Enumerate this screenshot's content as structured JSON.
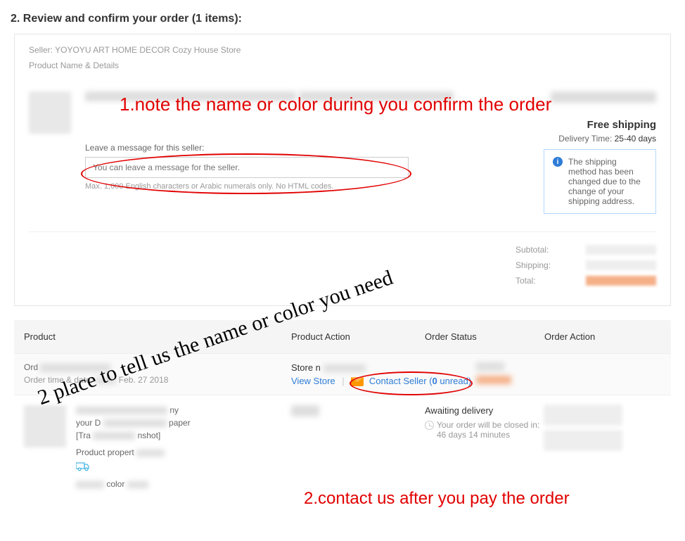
{
  "page_title": "2. Review and confirm your order (1 items):",
  "seller": {
    "label": "Seller:",
    "name": "YOYOYU ART HOME DECOR Cozy House Store"
  },
  "product_header": "Product Name & Details",
  "shipping": {
    "free_label": "Free shipping",
    "delivery_prefix": "Delivery Time:",
    "delivery_value": "25-40 days",
    "info_text": "The shipping method has been changed due to the change of your shipping address."
  },
  "message": {
    "label": "Leave a message for this seller:",
    "placeholder": "You can leave a message for the seller.",
    "hint": "Max. 1,000 English characters or Arabic numerals only. No HTML codes."
  },
  "totals": {
    "subtotal": "Subtotal:",
    "shipping": "Shipping:",
    "total": "Total:"
  },
  "list_headers": {
    "product": "Product",
    "product_action": "Product Action",
    "order_status": "Order Status",
    "order_action": "Order Action"
  },
  "order": {
    "ord_prefix": "Ord",
    "time_prefix": "Order time & date:",
    "time_partial": "Feb. 27 2018",
    "store_prefix": "Store n",
    "view_store": "View Store",
    "contact_seller": "Contact Seller",
    "unread_open": "(",
    "unread_count": "0",
    "unread_close": " unread)"
  },
  "product_row": {
    "line1_suffix": "ny",
    "line1b": "your D",
    "line1c": "paper",
    "line2": "[Tra",
    "line2b": "nshot]",
    "props_label": "Product propert",
    "color_label": "color"
  },
  "status": {
    "awaiting": "Awaiting delivery",
    "close_text": "Your order will be closed in: 46 days 14 minutes"
  },
  "annotations": {
    "note1": "1.note the name or color during you confirm the order",
    "cursive": "2 place to tell us the name or color you need",
    "note2": "2.contact us after you pay the order"
  }
}
